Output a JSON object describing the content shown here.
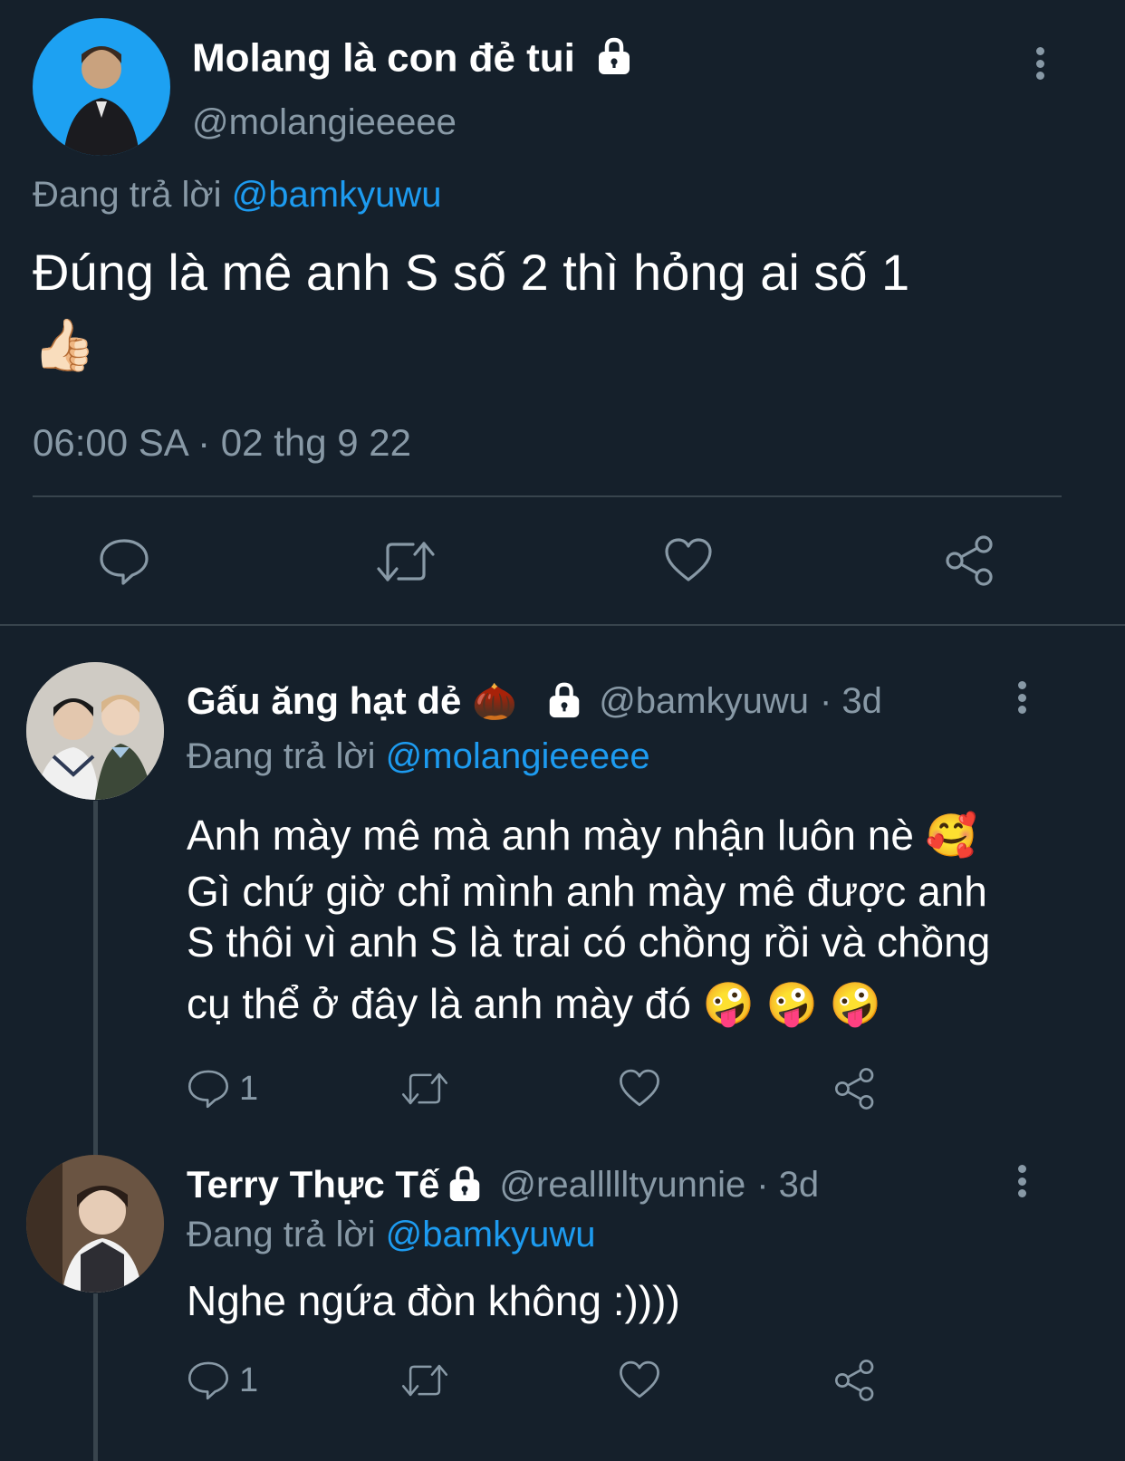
{
  "main_tweet": {
    "author_name": "Molang là con đẻ tui",
    "handle": "@molangieeeee",
    "replying_prefix": "Đang trả lời",
    "replying_to": "@bamkyuwu",
    "text": "Đúng là mê anh S số 2 thì hỏng ai số 1",
    "emoji": "👍🏻",
    "timestamp": "06:00 SA · 02 thg 9 22"
  },
  "replies": [
    {
      "author_name": "Gấu ăng hạt dẻ",
      "name_emoji": "🌰",
      "handle": "@bamkyuwu",
      "time": "· 3d",
      "replying_prefix": "Đang trả lời",
      "replying_to": "@molangieeeee",
      "lines": [
        "Anh mày mê mà anh mày nhận luôn nè 🥰",
        "Gì chứ giờ chỉ mình anh mày mê được anh",
        "S thôi vì anh S là trai có chồng rồi và chồng",
        "cụ thể ở đây là anh mày đó 🤪 🤪 🤪"
      ],
      "reply_count": "1"
    },
    {
      "author_name": "Terry Thực Tế",
      "handle": "@reallllltyunnie",
      "time": "· 3d",
      "replying_prefix": "Đang trả lời",
      "replying_to": "@bamkyuwu",
      "text": "Nghe ngứa đòn không :))))",
      "reply_count": "1"
    }
  ],
  "icons": {
    "reply": "speech-bubble-icon",
    "retweet": "retweet-icon",
    "like": "heart-icon",
    "share": "share-icon",
    "lock": "lock-icon",
    "more": "more-vertical-icon"
  },
  "colors": {
    "background": "#15202b",
    "text": "#ffffff",
    "muted": "#8899a6",
    "link": "#1d9bf0",
    "divider": "#38444d"
  }
}
